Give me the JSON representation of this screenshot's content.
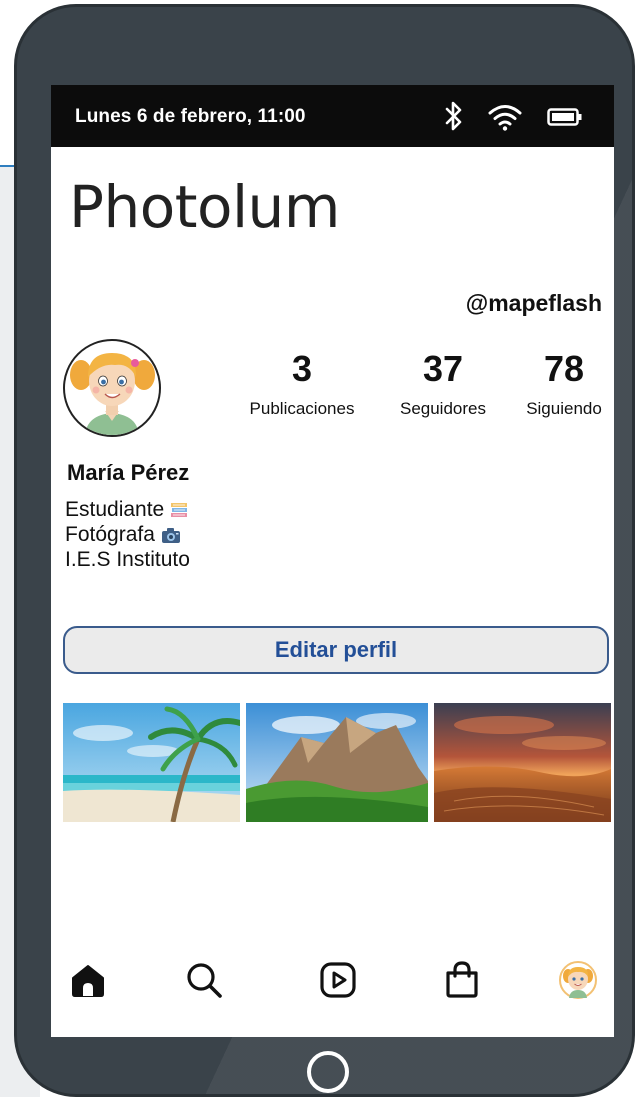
{
  "status_bar": {
    "datetime": "Lunes 6 de febrero, 11:00",
    "icons": [
      "bluetooth-icon",
      "wifi-icon",
      "battery-icon"
    ]
  },
  "app": {
    "title": "Photolum"
  },
  "profile": {
    "username": "@mapeflash",
    "name": "María Pérez",
    "stats": [
      {
        "value": "3",
        "label": "Publicaciones"
      },
      {
        "value": "37",
        "label": "Seguidores"
      },
      {
        "value": "78",
        "label": "Siguiendo"
      }
    ],
    "bio": [
      {
        "text": "Estudiante",
        "icon": "books-icon"
      },
      {
        "text": "Fotógrafa",
        "icon": "camera-icon"
      },
      {
        "text": "I.E.S Instituto",
        "icon": ""
      }
    ],
    "edit_button_label": "Editar perfil"
  },
  "posts": [
    {
      "subject": "tropical-beach"
    },
    {
      "subject": "green-mountains"
    },
    {
      "subject": "desert-sunset"
    }
  ],
  "nav": {
    "items": [
      "home-icon",
      "search-icon",
      "reels-icon",
      "shop-icon",
      "profile-avatar"
    ]
  },
  "colors": {
    "accent": "#234f97",
    "button_border": "#3a5b8c",
    "phone_body": "#3a434a",
    "status_bar": "#0c0c0c"
  }
}
